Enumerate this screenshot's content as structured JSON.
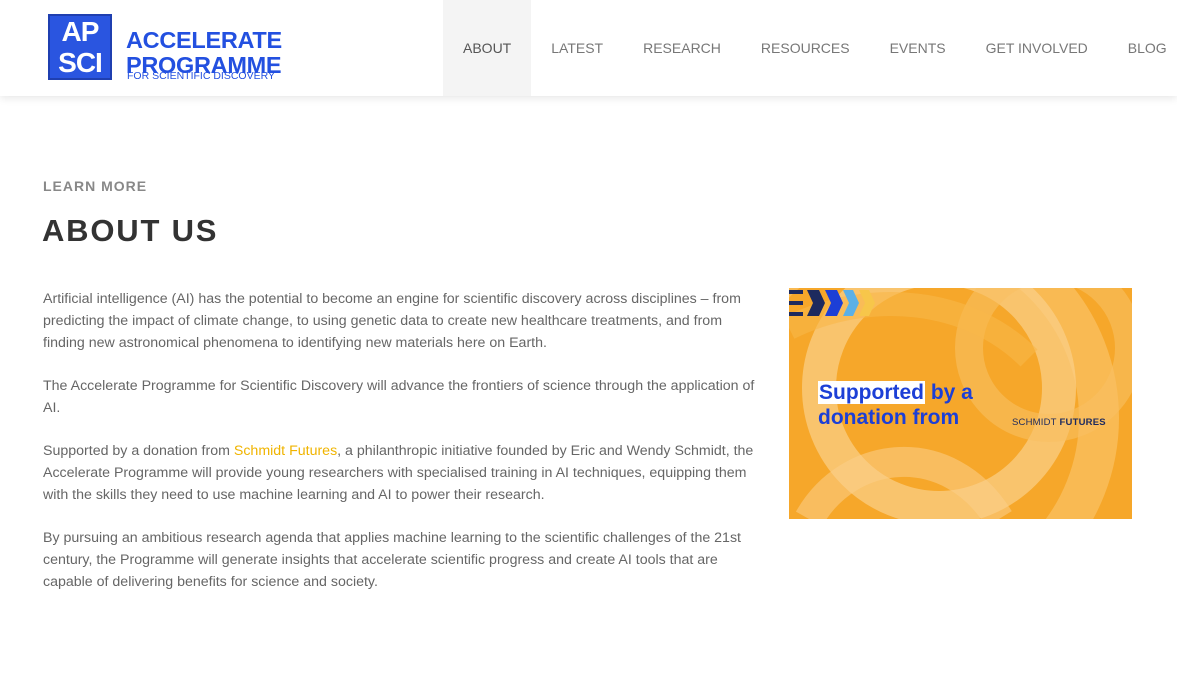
{
  "logo": {
    "box_letters": [
      "AP",
      "SCI"
    ],
    "title_line1": "ACCELERATE",
    "title_line2": "PROGRAMME",
    "subtitle": "FOR SCIENTIFIC DISCOVERY"
  },
  "nav": {
    "items": [
      {
        "label": "ABOUT",
        "active": true
      },
      {
        "label": "LATEST",
        "active": false
      },
      {
        "label": "RESEARCH",
        "active": false
      },
      {
        "label": "RESOURCES",
        "active": false
      },
      {
        "label": "EVENTS",
        "active": false
      },
      {
        "label": "GET INVOLVED",
        "active": false
      },
      {
        "label": "BLOG",
        "active": false
      }
    ]
  },
  "main": {
    "eyebrow": "LEARN MORE",
    "title": "ABOUT US",
    "paragraphs": {
      "p1": "Artificial intelligence (AI) has the potential to become an engine for scientific discovery across disciplines – from predicting the impact of climate change, to using genetic data to create new healthcare treatments, and from finding new astronomical phenomena to identifying new materials here on Earth.",
      "p2": "The Accelerate Programme for Scientific Discovery will advance the frontiers of science through the application of AI.",
      "p3_before": "Supported by a donation from ",
      "p3_link": "Schmidt Futures",
      "p3_after": ", a philanthropic initiative founded by Eric and Wendy Schmidt, the Accelerate Programme will provide young researchers with specialised training in AI techniques, equipping them with the skills they need to use machine learning and AI to power their research.",
      "p4": "By pursuing an ambitious research agenda that applies machine learning to the scientific challenges of the 21st century, the Programme will generate insights that accelerate scientific progress and create AI tools that are capable of delivering benefits for science and society."
    }
  },
  "banner": {
    "line1_highlight": "Supported",
    "line1_rest": " by a",
    "line2": "donation from",
    "sponsor_word1": "SCHMIDT",
    "sponsor_word2": "FUTURES"
  },
  "colors": {
    "link": "#f0b400",
    "banner_bg": "#f6a72a",
    "brand_blue": "#2350e0"
  }
}
